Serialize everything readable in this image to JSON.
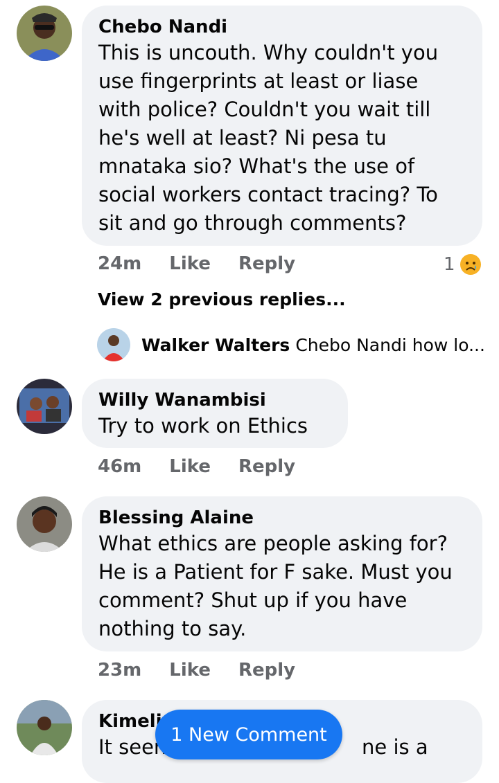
{
  "comments": [
    {
      "author": "Chebo Nandi",
      "text": [
        "This is uncouth. Why couldn't you",
        "use fingerprints at least or liase",
        "with police? Couldn't you wait till",
        "he's well at least? Ni pesa tu",
        "mnataka sio? What's the use of",
        "social workers contact tracing? To",
        "sit and go through comments?"
      ],
      "time": "24m",
      "like": "Like",
      "reply": "Reply",
      "reaction_count": "1",
      "reaction_icon": "sad-cry-emoji-icon",
      "view_replies": "View 2 previous replies...",
      "latest_reply": {
        "author": "Walker Walters",
        "text": "Chebo Nandi how lo..."
      }
    },
    {
      "author": "Willy Wanambisi",
      "text": [
        "Try to work  on Ethics"
      ],
      "time": "46m",
      "like": "Like",
      "reply": "Reply"
    },
    {
      "author": "Blessing Alaine",
      "text": [
        "What ethics are people asking for?",
        "He is a Patient for F sake. Must you",
        "comment? Shut up if you have",
        "nothing to say."
      ],
      "time": "23m",
      "like": "Like",
      "reply": "Reply"
    },
    {
      "author": "Kimeli",
      "text_left": "It seen",
      "text_right": "ne is  a"
    }
  ],
  "new_comment_label": "1 New Comment",
  "colors": {
    "bubble": "#f0f2f5",
    "meta": "#65676b",
    "accent": "#1877f2"
  }
}
